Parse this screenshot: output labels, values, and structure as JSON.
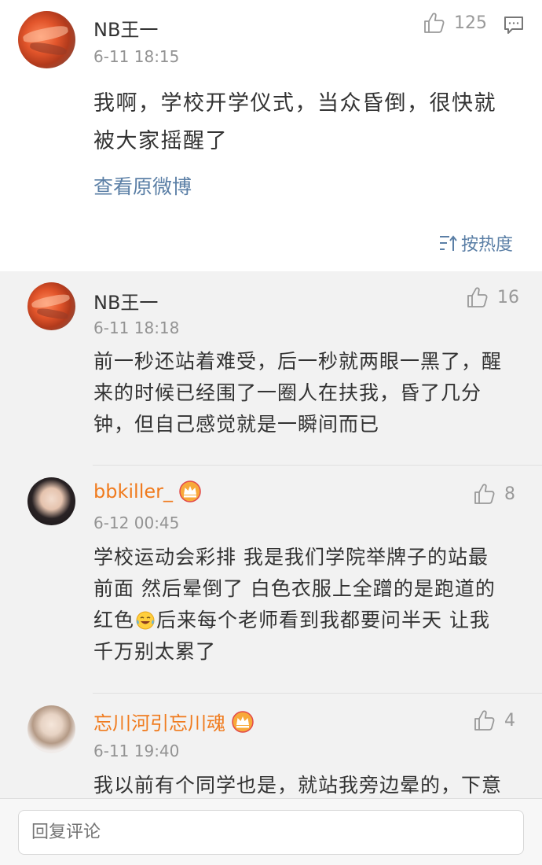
{
  "post": {
    "author": "NB王一",
    "time": "6-11 18:15",
    "likes": "125",
    "content_line1": "我啊，学校开学仪式，当众昏倒，很快就",
    "content_line2": "被大家摇醒了",
    "view_original": "查看原微博",
    "sort_label": "按热度"
  },
  "comments": [
    {
      "author": "NB王一",
      "time": "6-11 18:18",
      "likes": "16",
      "lines": [
        "前一秒还站着难受，后一秒就两眼一黑了，醒",
        "来的时候已经围了一圈人在扶我，昏了几分",
        "钟，但自己感觉就是一瞬间而已"
      ]
    },
    {
      "author": "bbkiller_",
      "time": "6-12 00:45",
      "likes": "8",
      "lines": [
        "学校运动会彩排 我是我们学院举牌子的站最",
        "前面 然后晕倒了 白色衣服上全蹭的是跑道的",
        "红色",
        "后来每个老师看到我都要问半天 让我",
        "千万别太累了"
      ]
    },
    {
      "author": "忘川河引忘川魂",
      "time": "6-11 19:40",
      "likes": "4",
      "lines": [
        "我以前有个同学也是，就站我旁边晕的，下意"
      ]
    }
  ],
  "reply": {
    "placeholder": "回复评论"
  },
  "colors": {
    "link": "#5b7fa6",
    "vip_name": "#f07b1e",
    "comment_bg": "#f2f2f2"
  },
  "icons": [
    "thumbs-up-icon",
    "comment-icon",
    "sort-icon",
    "vip-crown-icon",
    "laughing-tears-emoji"
  ]
}
